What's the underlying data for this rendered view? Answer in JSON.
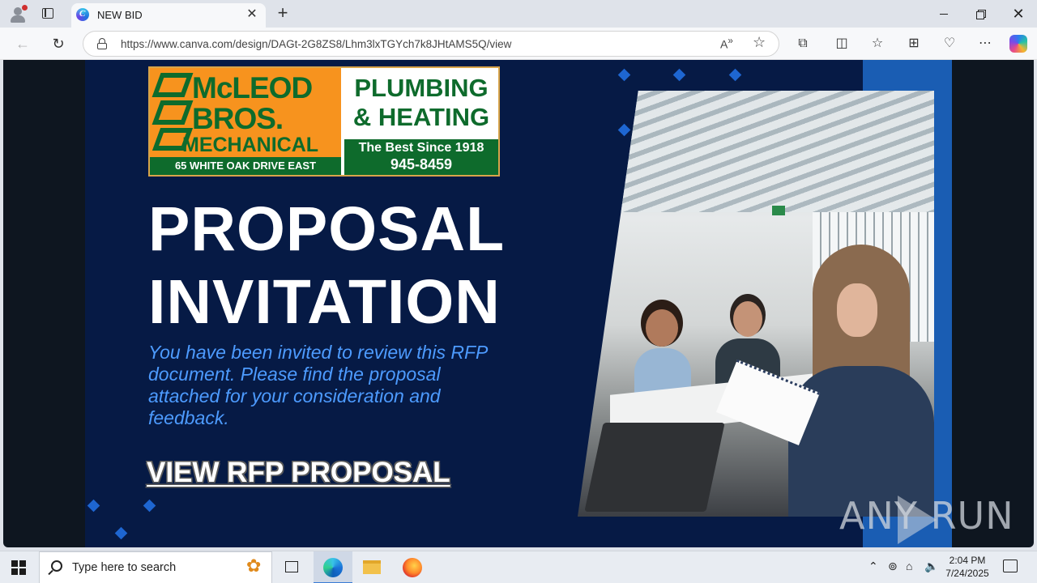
{
  "browser": {
    "tab_title": "NEW BID",
    "tab_close": "✕",
    "new_tab": "+",
    "url": "https://www.canva.com/design/DAGt-2G8ZS8/Lhm3lxTGYch7k8JHtAMS5Q/view",
    "window_close": "✕"
  },
  "page": {
    "logo": {
      "line1": "McLEOD",
      "line2": "BROS.",
      "line3": "MECHANICAL",
      "address": "65 WHITE OAK DRIVE EAST",
      "service1": "PLUMBING",
      "service2": "& HEATING",
      "tagline": "The Best Since 1918",
      "phone": "945-8459"
    },
    "heading_line1": "PROPOSAL",
    "heading_line2": "INVITATION",
    "description": "You have been invited to review this RFP document. Please find the proposal attached for your consideration and feedback.",
    "cta": "VIEW RFP PROPOSAL",
    "watermark": "ANY RUN"
  },
  "taskbar": {
    "search_placeholder": "Type here to search",
    "time": "2:04 PM",
    "date": "7/24/2025"
  },
  "colors": {
    "design_bg": "#061a45",
    "accent_blue": "#1a5db3",
    "description_text": "#4d9bff",
    "logo_orange": "#f7931e",
    "logo_green": "#0e6b2c"
  }
}
